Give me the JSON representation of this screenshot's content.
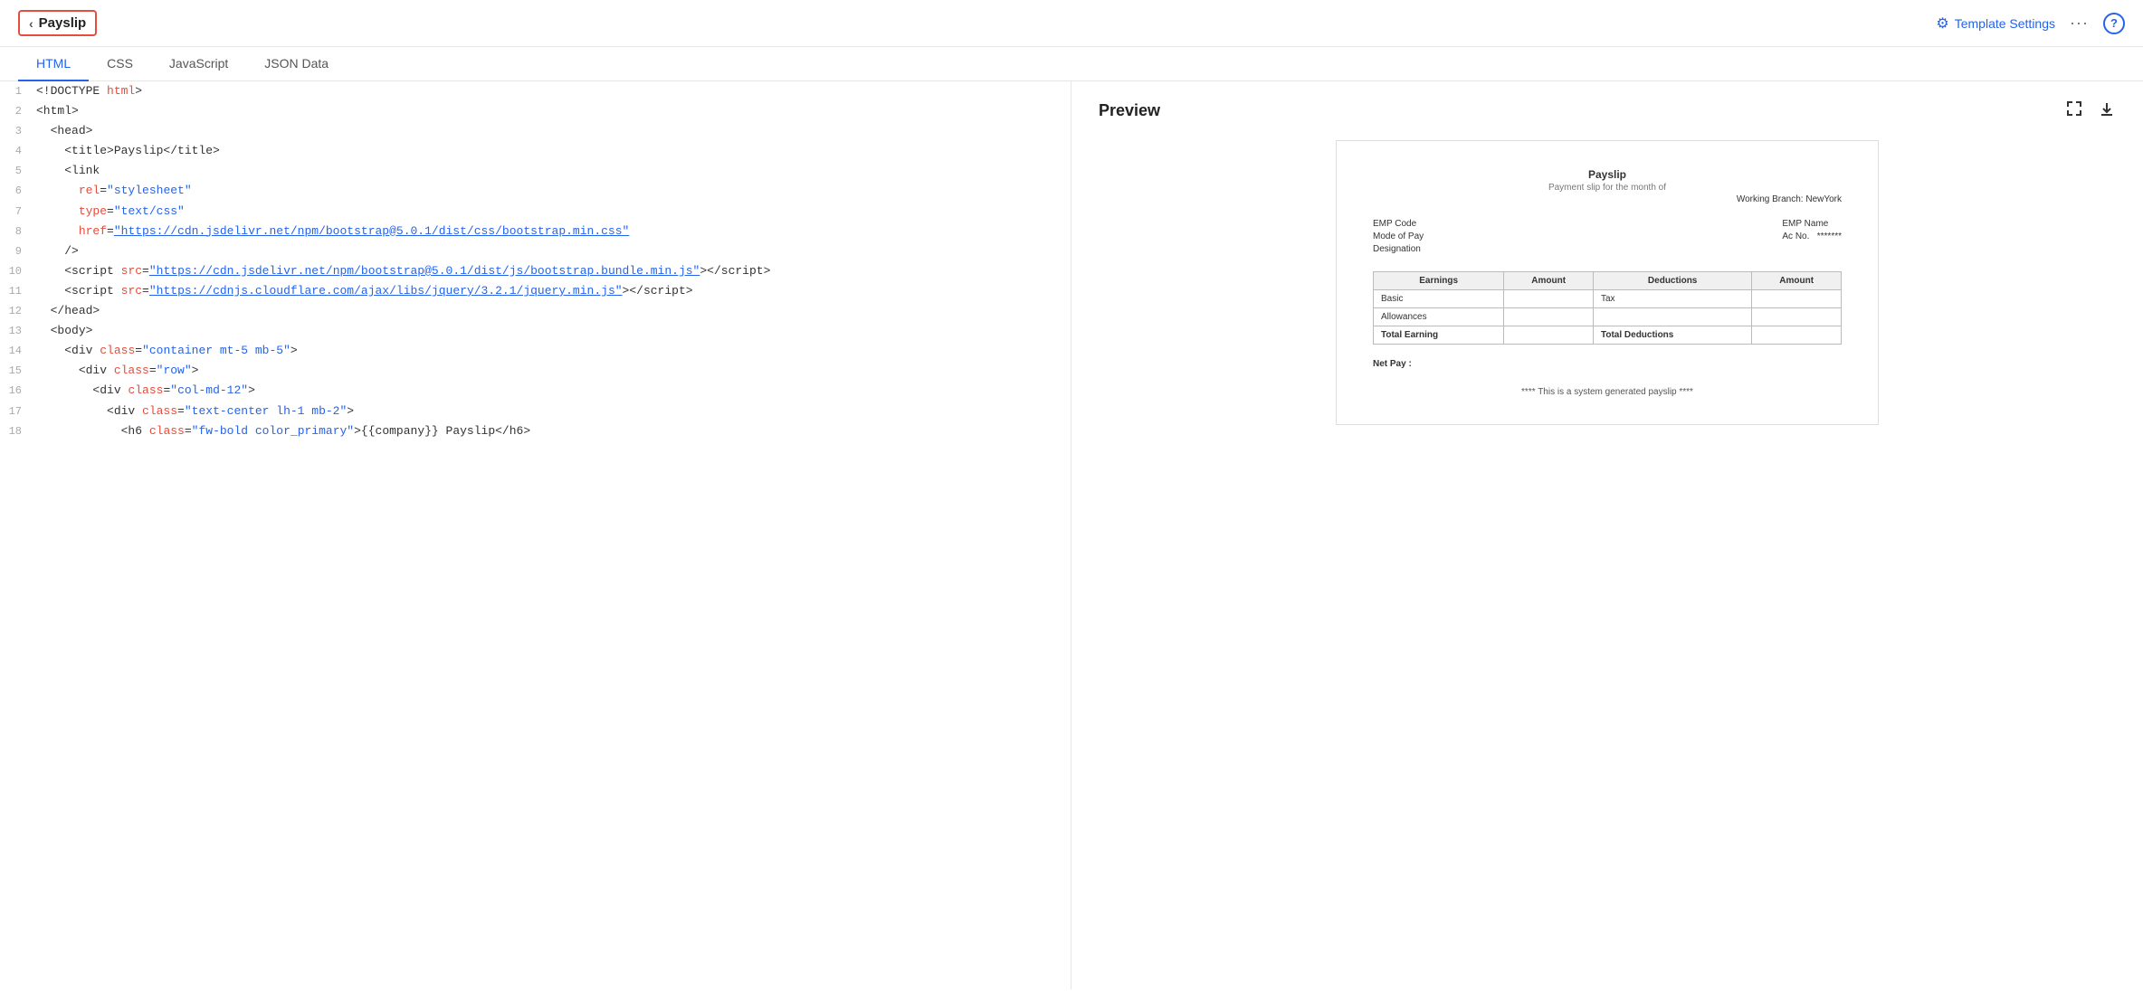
{
  "header": {
    "back_label": "Payslip",
    "template_settings_label": "Template Settings",
    "more_label": "···",
    "help_label": "?"
  },
  "tabs": [
    {
      "id": "html",
      "label": "HTML",
      "active": true
    },
    {
      "id": "css",
      "label": "CSS",
      "active": false
    },
    {
      "id": "javascript",
      "label": "JavaScript",
      "active": false
    },
    {
      "id": "json-data",
      "label": "JSON Data",
      "active": false
    }
  ],
  "code_lines": [
    {
      "num": "1",
      "html": "&lt;!DOCTYPE <span class='comment'>html</span>&gt;"
    },
    {
      "num": "2",
      "html": "&lt;html&gt;"
    },
    {
      "num": "3",
      "html": "  &lt;head&gt;"
    },
    {
      "num": "4",
      "html": "    &lt;title&gt;Payslip&lt;/title&gt;"
    },
    {
      "num": "5",
      "html": "    &lt;link"
    },
    {
      "num": "6",
      "html": "      <span class='attr-name'>rel</span>=<span class='attr-val-plain'>\"stylesheet\"</span>"
    },
    {
      "num": "7",
      "html": "      <span class='attr-name'>type</span>=<span class='attr-val-plain'>\"text/css\"</span>"
    },
    {
      "num": "8",
      "html": "      <span class='attr-name'>href</span>=<span class='attr-val'>\"https://cdn.jsdelivr.net/npm/bootstrap@5.0.1/dist/css/bootstrap.min.css\"</span>"
    },
    {
      "num": "9",
      "html": "    /&gt;"
    },
    {
      "num": "10",
      "html": "    &lt;script <span class='attr-name'>src</span>=<span class='attr-val'>\"https://cdn.jsdelivr.net/npm/bootstrap@5.0.1/dist/js/bootstrap.bundle.min.js\"</span>&gt;&lt;/script&gt;"
    },
    {
      "num": "11",
      "html": "    &lt;script <span class='attr-name'>src</span>=<span class='attr-val'>\"https://cdnjs.cloudflare.com/ajax/libs/jquery/3.2.1/jquery.min.js\"</span>&gt;&lt;/script&gt;"
    },
    {
      "num": "12",
      "html": "  &lt;/head&gt;"
    },
    {
      "num": "13",
      "html": "  &lt;body&gt;"
    },
    {
      "num": "14",
      "html": "    &lt;div <span class='attr-name'>class</span>=<span class='attr-val-plain'>\"container mt-5 mb-5\"</span>&gt;"
    },
    {
      "num": "15",
      "html": "      &lt;div <span class='attr-name'>class</span>=<span class='attr-val-plain'>\"row\"</span>&gt;"
    },
    {
      "num": "16",
      "html": "        &lt;div <span class='attr-name'>class</span>=<span class='attr-val-plain'>\"col-md-12\"</span>&gt;"
    },
    {
      "num": "17",
      "html": "          &lt;div <span class='attr-name'>class</span>=<span class='attr-val-plain'>\"text-center lh-1 mb-2\"</span>&gt;"
    },
    {
      "num": "18",
      "html": "            &lt;h6 <span class='attr-name'>class</span>=<span class='attr-val-plain'>\"fw-bold color_primary\"</span>&gt;{{company}} Payslip&lt;/h6&gt;"
    }
  ],
  "preview": {
    "title": "Preview",
    "payslip": {
      "title": "Payslip",
      "subtitle": "Payment slip for the month of",
      "branch": "Working Branch: NewYork",
      "emp_code_label": "EMP Code",
      "emp_name_label": "EMP Name",
      "mode_label": "Mode of Pay",
      "ac_label": "Ac No.",
      "ac_value": "*******",
      "designation_label": "Designation",
      "table_headers": [
        "Earnings",
        "Amount",
        "Deductions",
        "Amount"
      ],
      "table_rows": [
        {
          "earning": "Basic",
          "earn_amount": "",
          "deduction": "Tax",
          "ded_amount": ""
        },
        {
          "earning": "Allowances",
          "earn_amount": "",
          "deduction": "",
          "ded_amount": ""
        },
        {
          "earning": "Total Earning",
          "earn_amount": "",
          "deduction": "Total Deductions",
          "ded_amount": ""
        }
      ],
      "net_pay_label": "Net Pay :",
      "footer": "**** This is a system generated payslip ****"
    }
  }
}
